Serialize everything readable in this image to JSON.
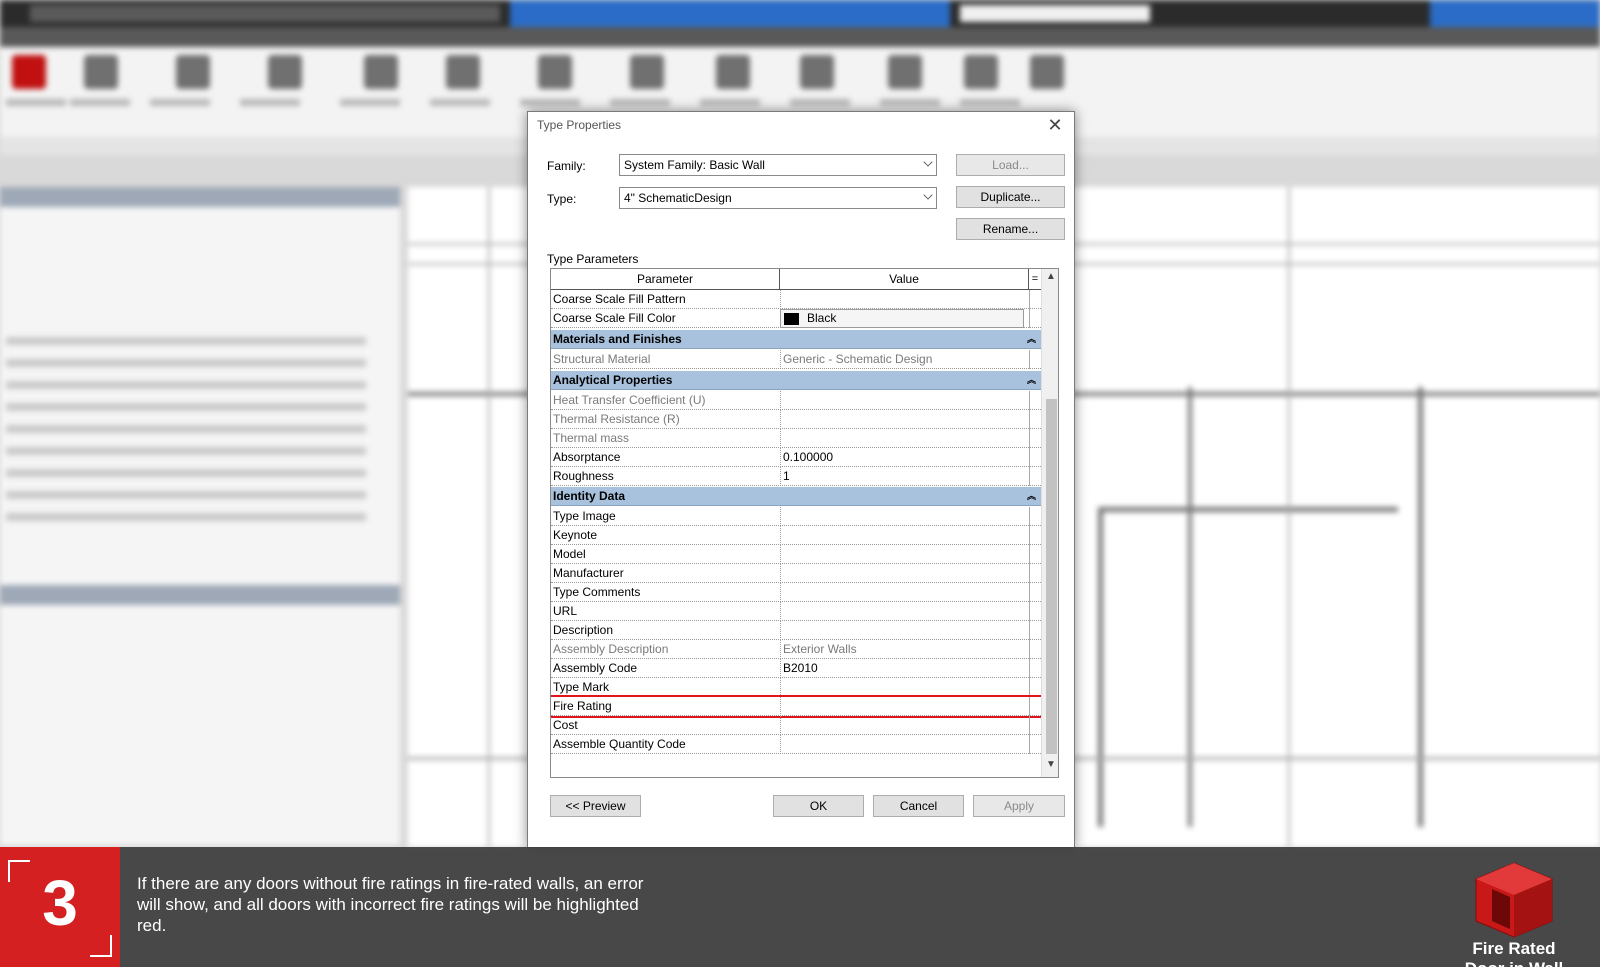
{
  "dialog": {
    "title": "Type Properties",
    "family_label": "Family:",
    "family_value": "System Family: Basic Wall",
    "type_label": "Type:",
    "type_value": "4\" SchematicDesign",
    "load_button": "Load...",
    "duplicate_button": "Duplicate...",
    "rename_button": "Rename...",
    "section_title": "Type Parameters",
    "col_parameter": "Parameter",
    "col_value": "Value",
    "col_extra": "=",
    "rows": [
      {
        "parameter": "Coarse Scale Fill Pattern",
        "value": ""
      },
      {
        "parameter": "Coarse Scale Fill Color",
        "value": "Black"
      },
      {
        "parameter": "Materials and Finishes",
        "value": ""
      },
      {
        "parameter": "Structural Material",
        "value": "Generic - Schematic Design"
      },
      {
        "parameter": "Analytical Properties",
        "value": ""
      },
      {
        "parameter": "Heat Transfer Coefficient (U)",
        "value": ""
      },
      {
        "parameter": "Thermal Resistance (R)",
        "value": ""
      },
      {
        "parameter": "Thermal mass",
        "value": ""
      },
      {
        "parameter": "Absorptance",
        "value": "0.100000"
      },
      {
        "parameter": "Roughness",
        "value": "1"
      },
      {
        "parameter": "Identity Data",
        "value": ""
      },
      {
        "parameter": "Type Image",
        "value": ""
      },
      {
        "parameter": "Keynote",
        "value": ""
      },
      {
        "parameter": "Model",
        "value": ""
      },
      {
        "parameter": "Manufacturer",
        "value": ""
      },
      {
        "parameter": "Type Comments",
        "value": ""
      },
      {
        "parameter": "URL",
        "value": ""
      },
      {
        "parameter": "Description",
        "value": ""
      },
      {
        "parameter": "Assembly Description",
        "value": "Exterior Walls"
      },
      {
        "parameter": "Assembly Code",
        "value": "B2010"
      },
      {
        "parameter": "Type Mark",
        "value": ""
      },
      {
        "parameter": "Fire Rating",
        "value": ""
      },
      {
        "parameter": "Cost",
        "value": ""
      },
      {
        "parameter": "Assemble Quantity Code",
        "value": ""
      }
    ],
    "preview_button": "<< Preview",
    "ok_button": "OK",
    "cancel_button": "Cancel",
    "apply_button": "Apply"
  },
  "banner": {
    "step_number": "3",
    "caption": "If there are any doors without fire ratings in fire-rated walls, an error will show, and all doors with incorrect fire ratings will be highlighted red.",
    "brand_line1": "Fire Rated",
    "brand_line2": "Door in Wall"
  },
  "colors": {
    "accent_red": "#d42020",
    "highlight_red": "#e0151c",
    "group_header": "#a8c2dd",
    "title_blue": "#2a6cc7"
  }
}
